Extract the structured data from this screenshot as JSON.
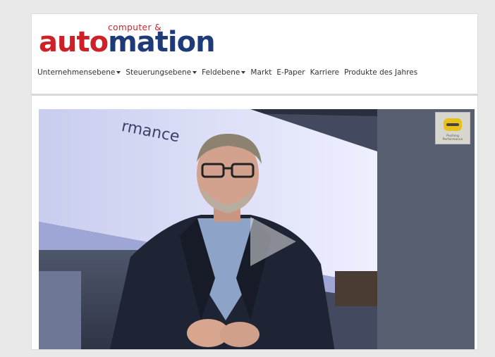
{
  "site": {
    "logo_small": "computer &",
    "logo_part1": "auto",
    "logo_part2": "mation"
  },
  "nav": {
    "items": [
      {
        "label": "Unternehmensebene",
        "has_dropdown": true
      },
      {
        "label": "Steuerungsebene",
        "has_dropdown": true
      },
      {
        "label": "Feldebene",
        "has_dropdown": true
      },
      {
        "label": "Markt",
        "has_dropdown": false
      },
      {
        "label": "E-Paper",
        "has_dropdown": false
      },
      {
        "label": "Karriere",
        "has_dropdown": false
      },
      {
        "label": "Produkte des Jahres",
        "has_dropdown": false
      }
    ]
  },
  "video": {
    "banner_text": "rmance",
    "vendor_tagline": "Pushing Performance",
    "play_icon": "play-icon"
  },
  "colors": {
    "brand_red": "#cf2027",
    "brand_blue": "#1e3a78"
  }
}
